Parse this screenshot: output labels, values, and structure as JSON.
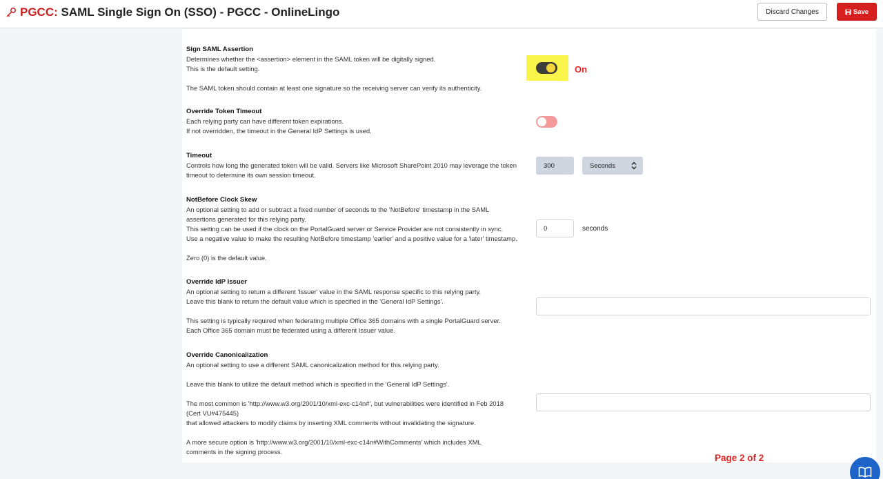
{
  "header": {
    "title_prefix": "PGCC:",
    "title": "SAML Single Sign On (SSO) - PGCC - OnlineLingo",
    "discard_label": "Discard Changes",
    "save_label": "Save"
  },
  "settings": {
    "sign_assertion": {
      "title": "Sign SAML Assertion",
      "lines": [
        "Determines whether the <assertion> element in the SAML token will be digitally signed.",
        "This is the default setting.",
        "",
        "The SAML token should contain at least one signature so the receiving server can verify its authenticity."
      ],
      "toggle_state": "On"
    },
    "override_timeout": {
      "title": "Override Token Timeout",
      "lines": [
        "Each relying party can have different token expirations.",
        "If not overridden, the timeout in the General IdP Settings is used."
      ]
    },
    "timeout": {
      "title": "Timeout",
      "lines": [
        "Controls how long the generated token will be valid. Servers like Microsoft SharePoint 2010 may leverage the token",
        "timeout to determine its own session timeout."
      ],
      "value": "300",
      "unit": "Seconds"
    },
    "clock_skew": {
      "title": "NotBefore Clock Skew",
      "lines": [
        "An optional setting to add or subtract a fixed number of seconds to the 'NotBefore' timestamp in the SAML",
        "assertions generated for this relying party.",
        "This setting can be used if the clock on the PortalGuard server or Service Provider are not consistently in sync.",
        "Use a negative value to make the resulting NotBefore timestamp 'earlier' and a positive value for a 'later' timestamp.",
        "",
        "Zero (0) is the default value."
      ],
      "value": "0",
      "unit": "seconds"
    },
    "override_issuer": {
      "title": "Override IdP Issuer",
      "lines": [
        "An optional setting to return a different 'Issuer' value in the SAML response specific to this relying party.",
        "Leave this blank to return the default value which is specified in the 'General IdP Settings'.",
        "",
        "This setting is typically required when federating multiple Office 365 domains with a single PortalGuard server.",
        "Each Office 365 domain must be federated using a different Issuer value."
      ],
      "value": ""
    },
    "override_canon": {
      "title": "Override Canonicalization",
      "lines": [
        "An optional setting to use a different SAML canonicalization method for this relying party.",
        "",
        "Leave this blank to utilize the default method which is specified in the 'General IdP Settings'.",
        "",
        "The most common is 'http://www.w3.org/2001/10/xml-exc-c14n#', but vulnerabilities were identified in Feb 2018",
        "(Cert VU#475445)",
        "that allowed attackers to modify claims by inserting XML comments without invalidating the signature.",
        "",
        "A more secure option is 'http://www.w3.org/2001/10/xml-exc-c14n#WithComments' which includes XML",
        "comments in the signing process."
      ],
      "value": ""
    }
  },
  "footer": {
    "page_indicator": "Page 2 of 2"
  },
  "colors": {
    "accent": "#d62020",
    "toggle_on": "#3d3d3d",
    "toggle_off": "#f59a9a",
    "highlight": "#f9f54a",
    "help_button": "#1e64c8"
  },
  "icons": [
    "key-icon",
    "save-icon",
    "chevron-updown-icon",
    "book-icon"
  ]
}
